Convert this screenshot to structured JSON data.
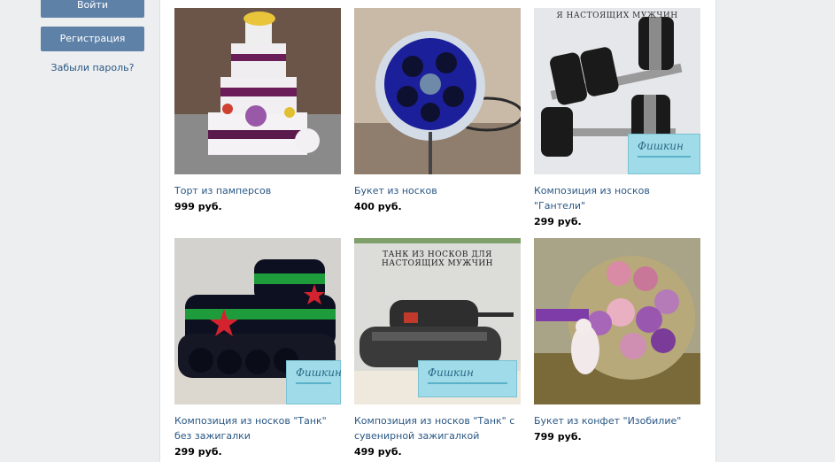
{
  "sidebar": {
    "login_label": "Войти",
    "register_label": "Регистрация",
    "forgot_label": "Забыли пароль?"
  },
  "products": [
    {
      "title": "Торт из памперсов",
      "price": "999 руб."
    },
    {
      "title": "Букет из носков",
      "price": "400 руб."
    },
    {
      "title": "Композиция из носков \"Гантели\"",
      "price": "299 руб.",
      "caption": "Я НАСТОЯЩИХ МУЖЧИН"
    },
    {
      "title": "Композиция из носков \"Танк\" без зажигалки",
      "price": "299 руб."
    },
    {
      "title": "Композиция из носков \"Танк\" с сувенирной зажигалкой",
      "price": "499 руб.",
      "caption": "ТАНК ИЗ НОСКОВ ДЛЯ НАСТОЯЩИХ МУЖЧИН"
    },
    {
      "title": "Букет из конфет \"Изобилие\"",
      "price": "799 руб."
    }
  ],
  "watermark": "Фишкин",
  "colors": {
    "link": "#2a5885",
    "button": "#5e81a8",
    "page_bg": "#edeef0"
  }
}
